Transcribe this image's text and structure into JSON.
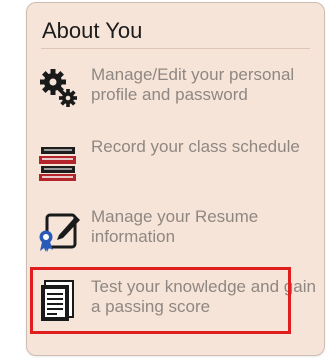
{
  "about": {
    "title": "About You",
    "items": [
      {
        "icon": "gears-icon",
        "label": "Manage/Edit your personal profile and password"
      },
      {
        "icon": "books-icon",
        "label": "Record your class schedule"
      },
      {
        "icon": "resume-icon",
        "label": "Manage your Resume information"
      },
      {
        "icon": "document-icon",
        "label": "Test your knowledge and gain a passing score"
      }
    ],
    "highlight_color": "#e01e1e"
  }
}
